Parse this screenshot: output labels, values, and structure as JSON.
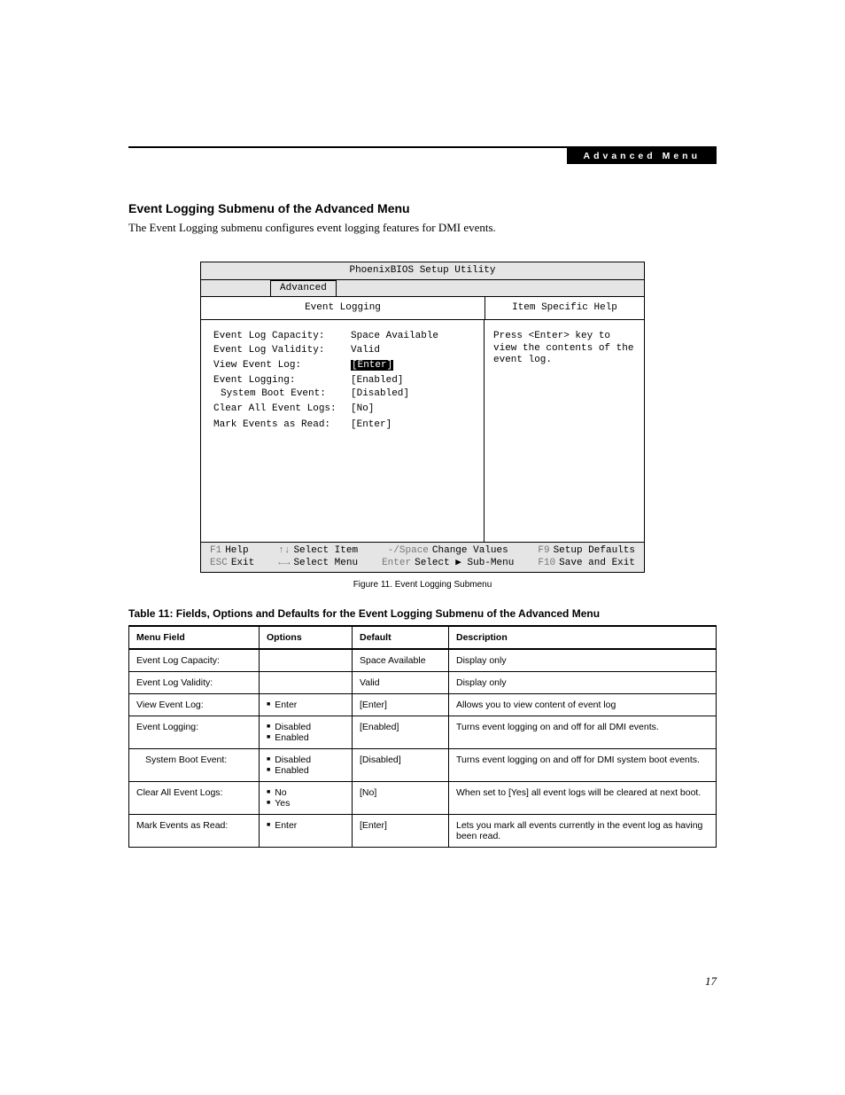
{
  "header": {
    "bar": "Advanced Menu"
  },
  "section": {
    "title": "Event Logging Submenu of the Advanced Menu",
    "intro": "The Event Logging submenu configures event logging features for DMI events."
  },
  "bios": {
    "title": "PhoenixBIOS Setup Utility",
    "tab": "Advanced",
    "subhead_left": "Event Logging",
    "subhead_right": "Item Specific Help",
    "help": "Press <Enter> key to view the contents of the event log.",
    "rows": [
      {
        "label": "Event Log Capacity:",
        "value": "Space Available",
        "indent": 0,
        "hl": 0
      },
      {
        "label": "Event Log Validity:",
        "value": "Valid",
        "indent": 0,
        "hl": 0
      },
      {
        "label": "",
        "value": "",
        "indent": 0,
        "hl": 0
      },
      {
        "label": "View Event Log:",
        "value": "[Enter]",
        "indent": 0,
        "hl": 1
      },
      {
        "label": "",
        "value": "",
        "indent": 0,
        "hl": 0
      },
      {
        "label": "Event Logging:",
        "value": "[Enabled]",
        "indent": 0,
        "hl": 0
      },
      {
        "label": "System Boot Event:",
        "value": "[Disabled]",
        "indent": 1,
        "hl": 0
      },
      {
        "label": "",
        "value": "",
        "indent": 0,
        "hl": 0
      },
      {
        "label": "Clear All Event Logs:",
        "value": "[No]",
        "indent": 0,
        "hl": 0
      },
      {
        "label": "",
        "value": "",
        "indent": 0,
        "hl": 0
      },
      {
        "label": "Mark Events as Read:",
        "value": "[Enter]",
        "indent": 0,
        "hl": 0
      }
    ],
    "footer": {
      "r1c1k": "F1",
      "r1c1t": "Help",
      "r1c2k": "↑↓",
      "r1c2t": "Select Item",
      "r1c3k": "-/Space",
      "r1c3t": "Change Values",
      "r1c4k": "F9",
      "r1c4t": "Setup Defaults",
      "r2c1k": "ESC",
      "r2c1t": "Exit",
      "r2c2k": "←→",
      "r2c2t": "Select Menu",
      "r2c3k": "Enter",
      "r2c3t": "Select ▶ Sub-Menu",
      "r2c4k": "F10",
      "r2c4t": "Save and Exit"
    }
  },
  "figure_caption": "Figure 11.  Event Logging Submenu",
  "table_caption": "Table 11: Fields, Options and Defaults for the Event Logging Submenu of the Advanced Menu",
  "table": {
    "headers": {
      "h1": "Menu Field",
      "h2": "Options",
      "h3": "Default",
      "h4": "Description"
    },
    "rows": [
      {
        "field": "Event Log Capacity:",
        "indent": 0,
        "options": [],
        "default": "Space Available",
        "desc": "Display only"
      },
      {
        "field": "Event Log Validity:",
        "indent": 0,
        "options": [],
        "default": "Valid",
        "desc": "Display only"
      },
      {
        "field": "View Event Log:",
        "indent": 0,
        "options": [
          "Enter"
        ],
        "default": "[Enter]",
        "desc": "Allows you to view content of event log"
      },
      {
        "field": "Event Logging:",
        "indent": 0,
        "options": [
          "Disabled",
          "Enabled"
        ],
        "default": "[Enabled]",
        "desc": "Turns event logging on and off for all DMI events."
      },
      {
        "field": "System Boot Event:",
        "indent": 1,
        "options": [
          "Disabled",
          "Enabled"
        ],
        "default": "[Disabled]",
        "desc": "Turns event logging on and off for DMI system boot events."
      },
      {
        "field": "Clear All Event Logs:",
        "indent": 0,
        "options": [
          "No",
          "Yes"
        ],
        "default": "[No]",
        "desc": "When set to [Yes] all event logs will be cleared at next boot."
      },
      {
        "field": "Mark Events as Read:",
        "indent": 0,
        "options": [
          "Enter"
        ],
        "default": "[Enter]",
        "desc": "Lets you mark all events currently in the event log as having been read."
      }
    ]
  },
  "page_number": "17"
}
